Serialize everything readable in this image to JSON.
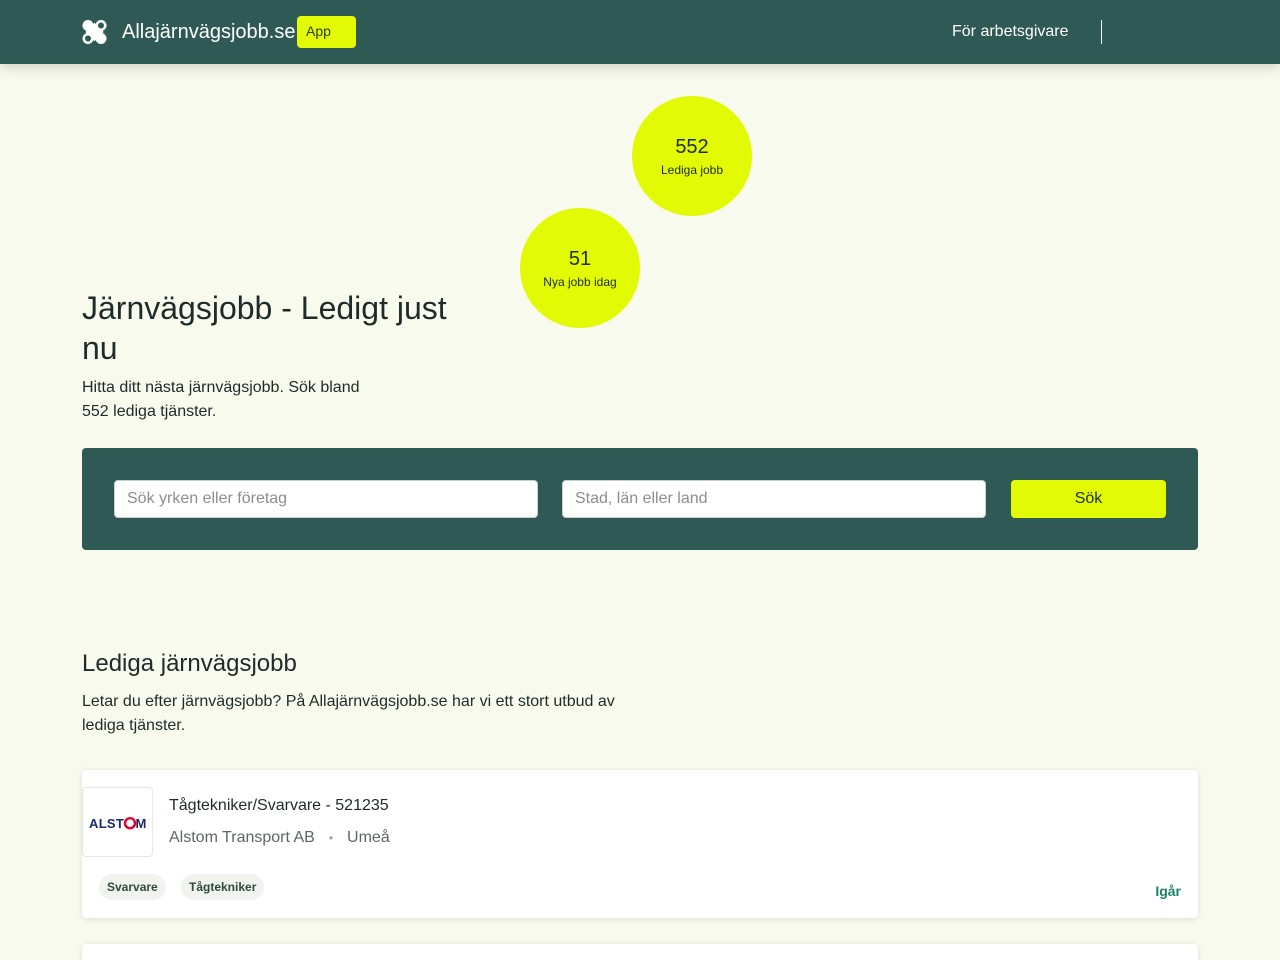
{
  "header": {
    "site_name": "Allajärnvägsjobb.se",
    "app_badge": "App",
    "employer_link": "För arbetsgivare"
  },
  "stats": [
    {
      "value": "552",
      "label": "Lediga jobb"
    },
    {
      "value": "51",
      "label": "Nya jobb idag"
    }
  ],
  "hero": {
    "title": "Järnvägsjobb - Ledigt just nu",
    "subtitle": "Hitta ditt nästa järnvägsjobb. Sök bland 552 lediga tjänster."
  },
  "search": {
    "what_placeholder": "Sök yrken eller företag",
    "where_placeholder": "Stad, län eller land",
    "button_label": "Sök"
  },
  "listing": {
    "title": "Lediga järnvägsjobb",
    "description": "Letar du efter järnvägsjobb? På Allajärnvägsjobb.se har vi ett stort utbud av lediga tjänster.",
    "jobs": [
      {
        "title": "Tågtekniker/Svarvare - 521235",
        "company": "Alstom Transport AB",
        "location": "Umeå",
        "tags": [
          "Svarvare",
          "Tågtekniker"
        ],
        "date": "Igår",
        "logo_text": "ALSTOM"
      }
    ]
  },
  "colors": {
    "header_bg": "#2f5954",
    "accent": "#e2fb04",
    "page_bg": "#f8faee",
    "date_green": "#1d8068",
    "alstom_red": "#e4002b",
    "alstom_blue": "#1a2a6c"
  },
  "icons": {
    "logo": "four-dots-logo-icon"
  }
}
